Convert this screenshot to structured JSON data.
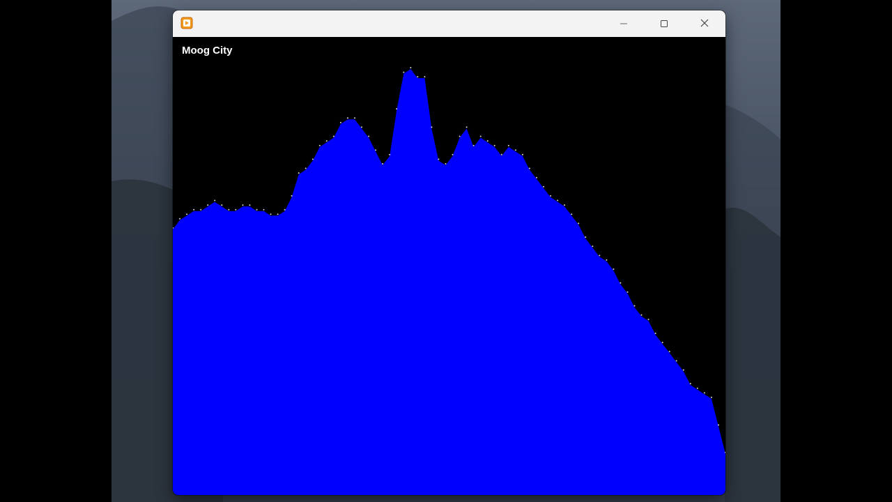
{
  "window": {
    "app_icon": "media-player-icon",
    "controls": [
      "minimize-icon",
      "maximize-icon",
      "close-icon"
    ]
  },
  "visualizer": {
    "track_title": "Moog City",
    "fill_color": "#0000ff",
    "peak_color": "#ffffff",
    "background_color": "#000000",
    "levels": [
      0.58,
      0.6,
      0.61,
      0.62,
      0.62,
      0.63,
      0.64,
      0.63,
      0.62,
      0.62,
      0.63,
      0.63,
      0.62,
      0.62,
      0.61,
      0.61,
      0.62,
      0.65,
      0.7,
      0.71,
      0.73,
      0.76,
      0.77,
      0.78,
      0.81,
      0.82,
      0.82,
      0.8,
      0.78,
      0.75,
      0.72,
      0.74,
      0.84,
      0.92,
      0.93,
      0.91,
      0.91,
      0.8,
      0.73,
      0.72,
      0.74,
      0.78,
      0.8,
      0.76,
      0.78,
      0.77,
      0.76,
      0.74,
      0.76,
      0.75,
      0.74,
      0.71,
      0.69,
      0.67,
      0.65,
      0.64,
      0.63,
      0.61,
      0.59,
      0.56,
      0.54,
      0.52,
      0.51,
      0.49,
      0.46,
      0.44,
      0.41,
      0.39,
      0.38,
      0.35,
      0.33,
      0.31,
      0.29,
      0.27,
      0.24,
      0.23,
      0.22,
      0.21,
      0.15,
      0.09
    ]
  }
}
